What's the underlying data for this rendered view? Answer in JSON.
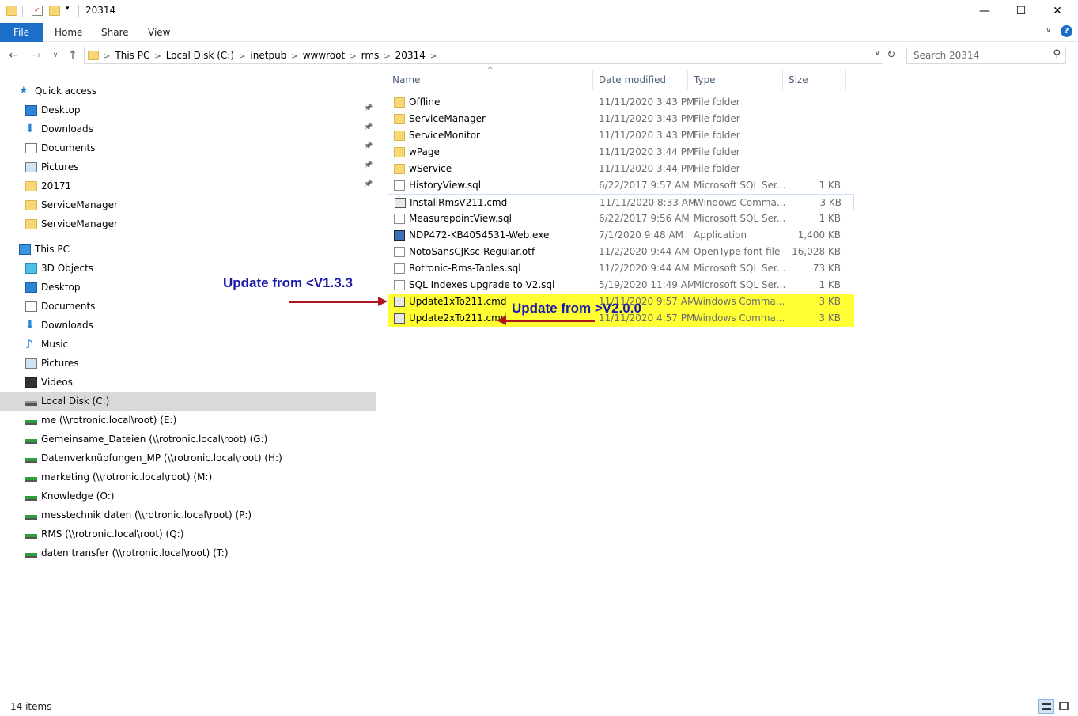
{
  "window": {
    "title": "20314"
  },
  "ribbon": {
    "tabs": [
      "File",
      "Home",
      "Share",
      "View"
    ]
  },
  "address": {
    "crumbs": [
      "This PC",
      "Local Disk (C:)",
      "inetpub",
      "wwwroot",
      "rms",
      "20314"
    ],
    "search_placeholder": "Search 20314"
  },
  "nav": {
    "quick_access": "Quick access",
    "quick_items": [
      "Desktop",
      "Downloads",
      "Documents",
      "Pictures",
      "20171",
      "ServiceManager",
      "ServiceManager"
    ],
    "this_pc": "This PC",
    "pc_items": [
      "3D Objects",
      "Desktop",
      "Documents",
      "Downloads",
      "Music",
      "Pictures",
      "Videos",
      "Local Disk (C:)"
    ],
    "drives": [
      "me (\\\\rotronic.local\\root) (E:)",
      "Gemeinsame_Dateien (\\\\rotronic.local\\root) (G:)",
      "Datenverknüpfungen_MP (\\\\rotronic.local\\root) (H:)",
      "marketing (\\\\rotronic.local\\root) (M:)",
      "Knowledge (O:)",
      "messtechnik daten (\\\\rotronic.local\\root) (P:)",
      "RMS (\\\\rotronic.local\\root) (Q:)",
      "daten transfer (\\\\rotronic.local\\root) (T:)"
    ]
  },
  "columns": {
    "name": "Name",
    "date": "Date modified",
    "type": "Type",
    "size": "Size"
  },
  "files": [
    {
      "name": "Offline",
      "date": "11/11/2020 3:43 PM",
      "type": "File folder",
      "size": ""
    },
    {
      "name": "ServiceManager",
      "date": "11/11/2020 3:43 PM",
      "type": "File folder",
      "size": ""
    },
    {
      "name": "ServiceMonitor",
      "date": "11/11/2020 3:43 PM",
      "type": "File folder",
      "size": ""
    },
    {
      "name": "wPage",
      "date": "11/11/2020 3:44 PM",
      "type": "File folder",
      "size": ""
    },
    {
      "name": "wService",
      "date": "11/11/2020 3:44 PM",
      "type": "File folder",
      "size": ""
    },
    {
      "name": "HistoryView.sql",
      "date": "6/22/2017 9:57 AM",
      "type": "Microsoft SQL Ser...",
      "size": "1 KB"
    },
    {
      "name": "InstallRmsV211.cmd",
      "date": "11/11/2020 8:33 AM",
      "type": "Windows Comma...",
      "size": "3 KB"
    },
    {
      "name": "MeasurepointView.sql",
      "date": "6/22/2017 9:56 AM",
      "type": "Microsoft SQL Ser...",
      "size": "1 KB"
    },
    {
      "name": "NDP472-KB4054531-Web.exe",
      "date": "7/1/2020 9:48 AM",
      "type": "Application",
      "size": "1,400 KB"
    },
    {
      "name": "NotoSansCJKsc-Regular.otf",
      "date": "11/2/2020 9:44 AM",
      "type": "OpenType font file",
      "size": "16,028 KB"
    },
    {
      "name": "Rotronic-Rms-Tables.sql",
      "date": "11/2/2020 9:44 AM",
      "type": "Microsoft SQL Ser...",
      "size": "73 KB"
    },
    {
      "name": "SQL Indexes upgrade to V2.sql",
      "date": "5/19/2020 11:49 AM",
      "type": "Microsoft SQL Ser...",
      "size": "1 KB"
    },
    {
      "name": "Update1xTo211.cmd",
      "date": "11/11/2020 9:57 AM",
      "type": "Windows Comma...",
      "size": "3 KB"
    },
    {
      "name": "Update2xTo211.cmd",
      "date": "11/11/2020 4:57 PM",
      "type": "Windows Comma...",
      "size": "3 KB"
    }
  ],
  "annotations": {
    "left": "Update from <V1.3.3",
    "right": "Update from >V2.0.0"
  },
  "status": {
    "count": "14 items"
  },
  "colors": {
    "highlight": "#ffff33",
    "annotation_text": "#1a1aa8",
    "arrow": "#b0161d",
    "file_tab": "#1c6fc8"
  }
}
